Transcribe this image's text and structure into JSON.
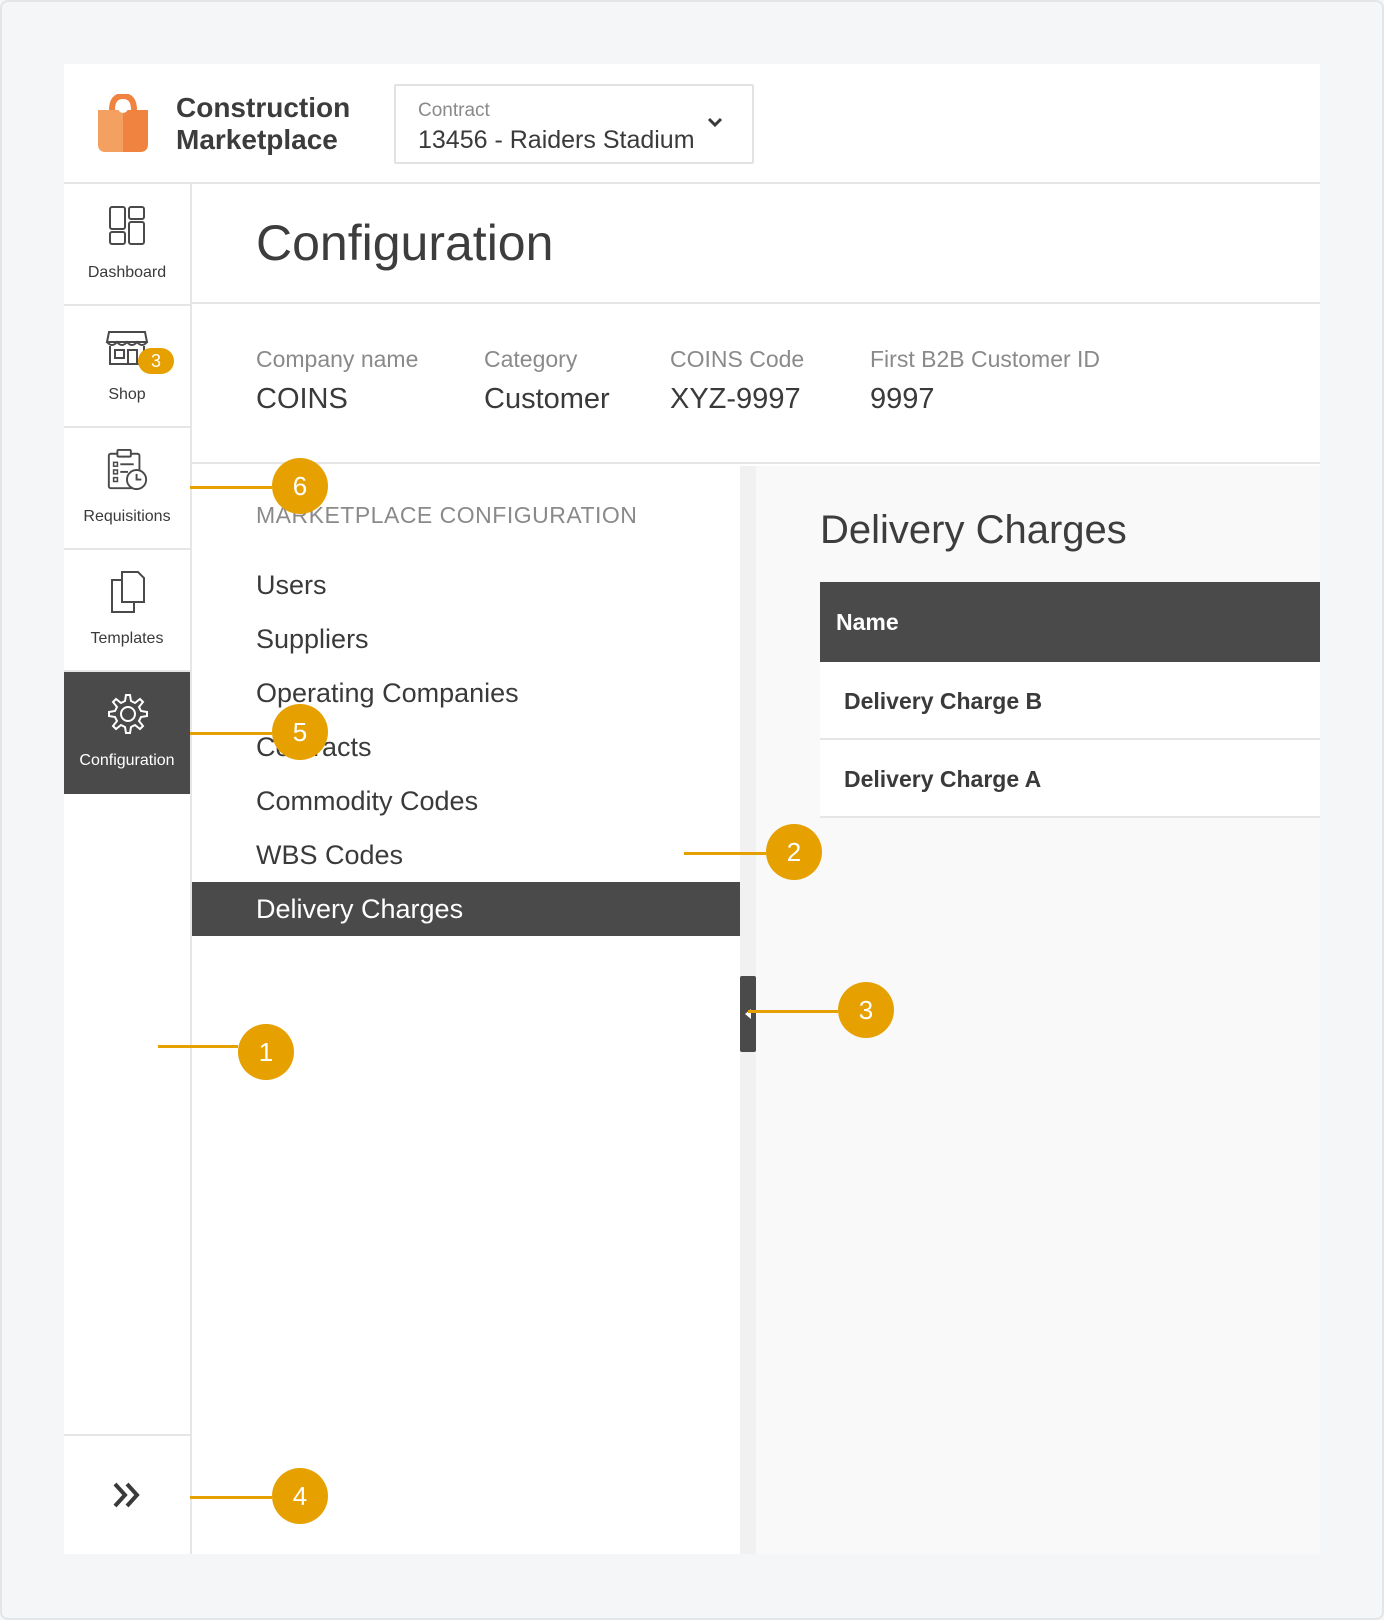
{
  "header": {
    "brand_line1": "Construction",
    "brand_line2": "Marketplace",
    "contract_label": "Contract",
    "contract_value": "13456 - Raiders Stadium"
  },
  "sidebar": {
    "items": [
      {
        "label": "Dashboard",
        "icon": "dashboard-icon"
      },
      {
        "label": "Shop",
        "icon": "shop-icon",
        "badge": "3"
      },
      {
        "label": "Requisitions",
        "icon": "requisitions-icon"
      },
      {
        "label": "Templates",
        "icon": "templates-icon"
      },
      {
        "label": "Configuration",
        "icon": "gear-icon",
        "active": true
      }
    ],
    "expand_icon": "double-chevron-right-icon"
  },
  "page": {
    "title": "Configuration"
  },
  "info": [
    {
      "key": "Company name",
      "value": "COINS"
    },
    {
      "key": "Category",
      "value": "Customer"
    },
    {
      "key": "COINS Code",
      "value": "XYZ-9997"
    },
    {
      "key": "First B2B Customer ID",
      "value": "9997"
    }
  ],
  "config_nav": {
    "section_title": "MARKETPLACE CONFIGURATION",
    "items": [
      "Users",
      "Suppliers",
      "Operating Companies",
      "Contracts",
      "Commodity Codes",
      "WBS Codes",
      "Delivery Charges"
    ],
    "active_index": 6
  },
  "content": {
    "title": "Delivery Charges",
    "table_header": "Name",
    "rows": [
      "Delivery Charge B",
      "Delivery Charge A"
    ]
  },
  "callouts": [
    "1",
    "2",
    "3",
    "4",
    "5",
    "6"
  ],
  "colors": {
    "accent": "#e6a100",
    "dark": "#4a4a4a",
    "logo": "#f07a3a"
  }
}
